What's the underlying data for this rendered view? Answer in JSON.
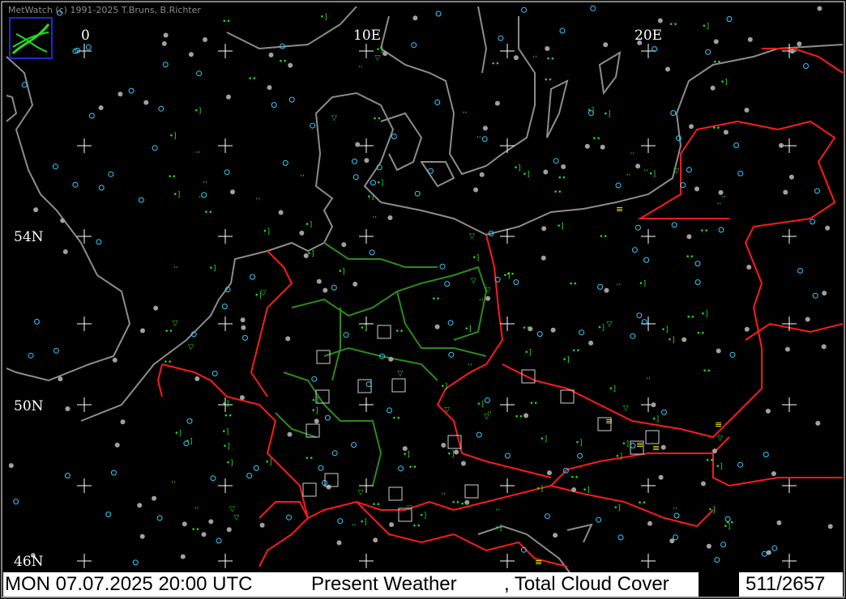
{
  "app": {
    "credit": "MetWatch  (c) 1991-2025 T.Bruns, B.Richter"
  },
  "grid": {
    "lon_labels": [
      "0",
      "10E",
      "20E"
    ],
    "lat_labels": [
      "54N",
      "50N",
      "46N"
    ]
  },
  "status": {
    "datetime": "MON 07.07.2025 20:00 UTC",
    "parameter_1": "Present Weather",
    "parameter_2": ", Total Cloud Cover",
    "counter": "511/2657"
  },
  "colors": {
    "background": "#000000",
    "coast": "#8c8c8c",
    "borders": "#ff1a1a",
    "regions": "#2c8a1a",
    "rain_symbol": "#22dd22",
    "fog_symbol": "#ffff00",
    "clear_station": "#33ccff",
    "cloudy_station": "#a0a0a0",
    "status_bar": "#ffffff"
  },
  "symbols": [
    "logo-icon",
    "station-marker-icon",
    "rain-symbol-icon",
    "fog-symbol-icon",
    "thunderstorm-symbol-icon"
  ]
}
